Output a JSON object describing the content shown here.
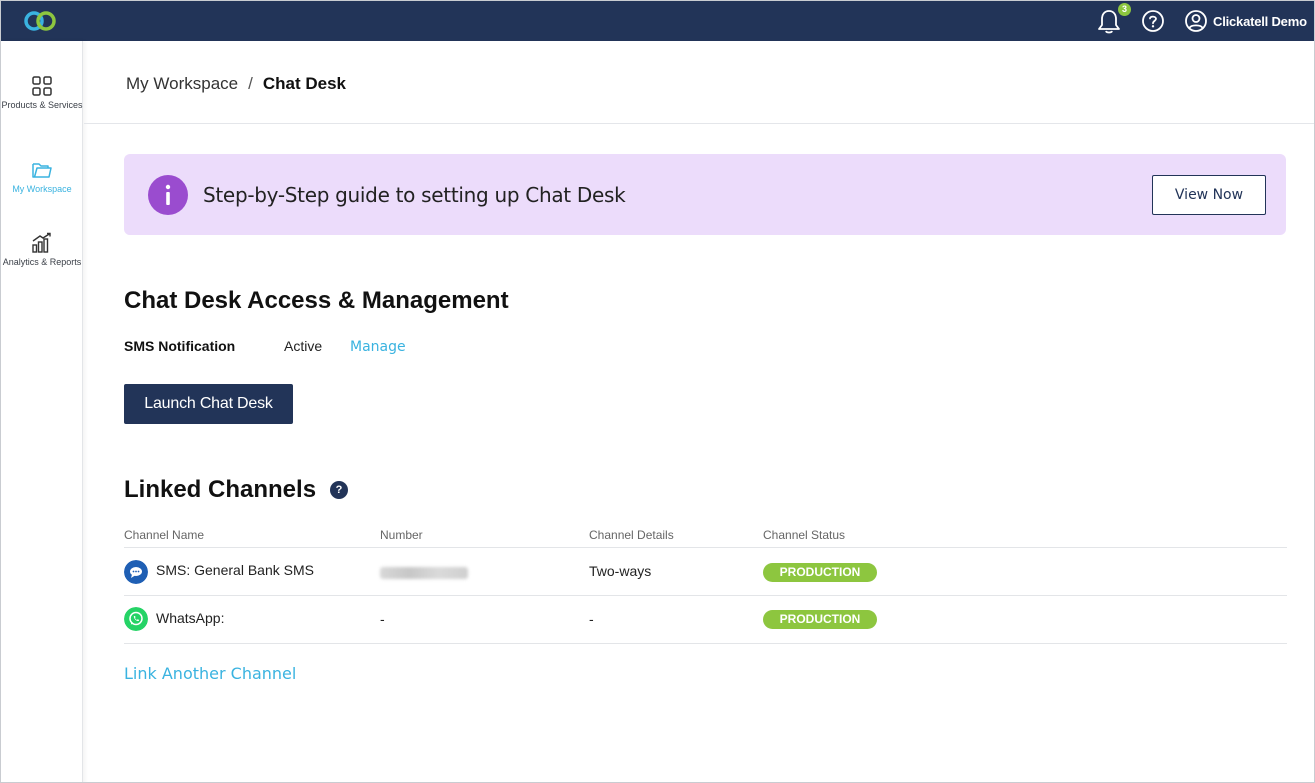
{
  "app": {
    "logo_icon": "clickatell-logo-icon",
    "notification_count": "3",
    "user_name": "Clickatell Demo",
    "colors": {
      "navy": "#223458",
      "accent": "#3ab3e0",
      "green": "#8dc63f",
      "purple": "#9a4ccf",
      "banner_bg": "#ecdcfb"
    }
  },
  "sidebar": {
    "items": [
      {
        "label": "Products & Services",
        "icon": "grid-icon",
        "active": false
      },
      {
        "label": "My Workspace",
        "icon": "folder-icon",
        "active": true
      },
      {
        "label": "Analytics & Reports",
        "icon": "bar-chart-icon",
        "active": false
      }
    ]
  },
  "breadcrumb": {
    "root": "My Workspace",
    "separator": "/",
    "current": "Chat Desk"
  },
  "banner": {
    "icon_glyph": "i",
    "text": "Step-by-Step guide to setting up Chat Desk",
    "button_label": "View Now"
  },
  "access": {
    "title": "Chat Desk Access & Management",
    "sms_label": "SMS Notification",
    "sms_status": "Active",
    "manage_label": "Manage",
    "launch_label": "Launch Chat Desk"
  },
  "channels": {
    "title": "Linked Channels",
    "help_glyph": "?",
    "columns": [
      "Channel Name",
      "Number",
      "Channel Details",
      "Channel Status"
    ],
    "rows": [
      {
        "name": "SMS: General Bank SMS",
        "icon": "sms-chat-icon",
        "number_blurred": true,
        "number": "",
        "details": "Two-ways",
        "status": "PRODUCTION"
      },
      {
        "name": "WhatsApp:",
        "icon": "whatsapp-icon",
        "number_blurred": false,
        "number": "-",
        "details": "-",
        "status": "PRODUCTION"
      }
    ],
    "link_another_label": "Link Another Channel"
  }
}
